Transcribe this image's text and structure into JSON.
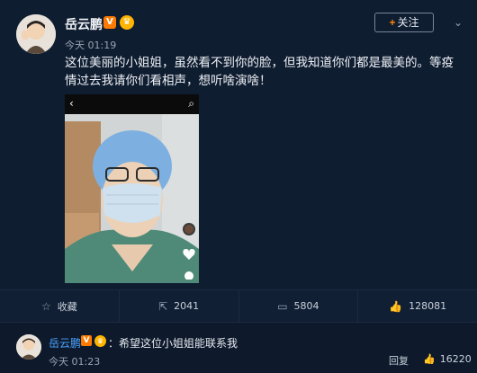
{
  "post": {
    "username": "岳云鹏",
    "v_badge": "V",
    "time_prefix": "今天",
    "time": "01:19",
    "follow_label": "关注",
    "text": "这位美丽的小姐姐，虽然看不到你的脸，但我知道你们都是最美的。等疫情过去我请你们看相声，想听啥演啥！",
    "media": {
      "back_icon": "‹",
      "search_icon": "⌕"
    }
  },
  "actions": [
    {
      "icon": "star-icon",
      "glyph": "☆",
      "label": "收藏"
    },
    {
      "icon": "share-icon",
      "glyph": "⇱",
      "label": "2041"
    },
    {
      "icon": "comment-icon",
      "glyph": "▭",
      "label": "5804"
    },
    {
      "icon": "like-icon",
      "glyph": "👍",
      "label": "128081"
    }
  ],
  "comment": {
    "username": "岳云鹏",
    "v_badge": "V",
    "text": "：希望这位小姐姐能联系我",
    "time_prefix": "今天",
    "time": "01:23",
    "reply_label": "回复",
    "like_count": "16220"
  },
  "colors": {
    "background": "#0e1a2c",
    "accent_orange": "#ff7a00",
    "link_blue": "#4aa3ff"
  }
}
